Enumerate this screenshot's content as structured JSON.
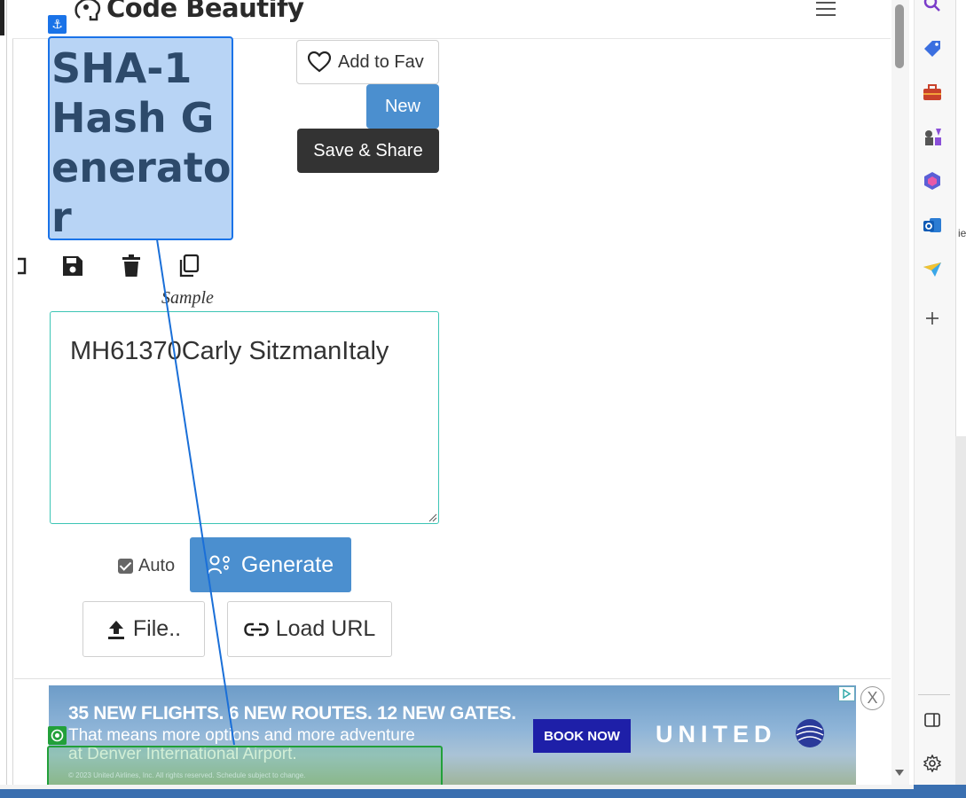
{
  "header": {
    "logo_text": "Code Beautify"
  },
  "title": "SHA-1 Hash Generator",
  "buttons": {
    "add_fav": "Add to Fav",
    "new": "New",
    "save_share": "Save & Share",
    "generate": "Generate",
    "file": "File..",
    "load_url": "Load URL"
  },
  "toolbar": {
    "sample_label": "Sample",
    "icons": [
      "expand-icon",
      "save-icon",
      "trash-icon",
      "copy-icon"
    ]
  },
  "input": {
    "value": "MH61370Carly SitzmanItaly"
  },
  "auto": {
    "label": "Auto",
    "checked": true
  },
  "ad": {
    "headline": "35 NEW FLIGHTS. 6 NEW ROUTES. 12 NEW GATES.",
    "line2": "That means more options and more adventure",
    "line3": "at Denver International Airport.",
    "copyright": "© 2023 United Airlines, Inc. All rights reserved. Schedule subject to change.",
    "cta": "BOOK NOW",
    "brand": "UNITED",
    "close": "X"
  },
  "edge_text": "ie",
  "colors": {
    "primary": "#4b8fcf",
    "dark": "#333333",
    "selection": "#1a73e8",
    "textarea_border": "#3cc5b5",
    "ad_cta": "#1e1fa8",
    "green_outline": "#22a03a"
  }
}
